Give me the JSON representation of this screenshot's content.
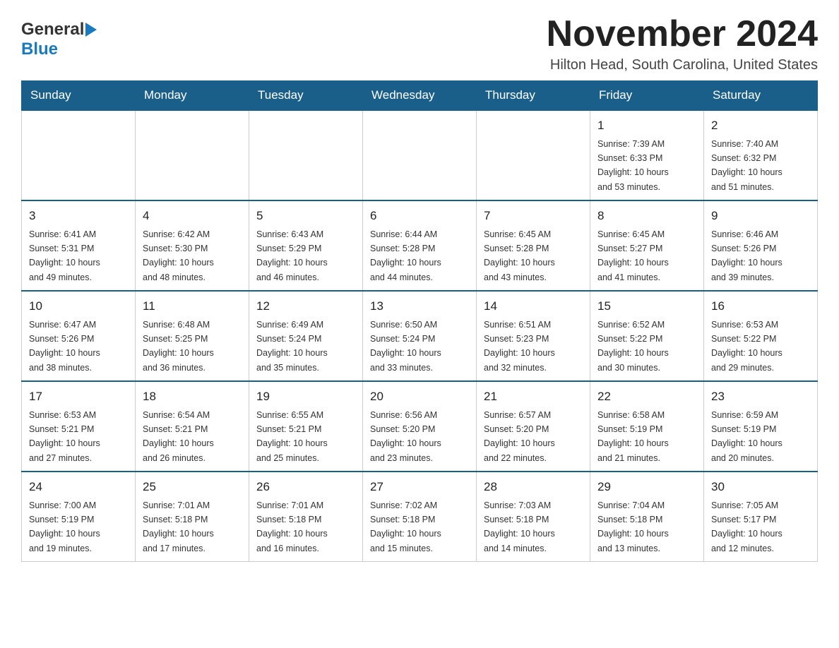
{
  "header": {
    "logo_general": "General",
    "logo_blue": "Blue",
    "month_title": "November 2024",
    "location": "Hilton Head, South Carolina, United States"
  },
  "calendar": {
    "days_of_week": [
      "Sunday",
      "Monday",
      "Tuesday",
      "Wednesday",
      "Thursday",
      "Friday",
      "Saturday"
    ],
    "weeks": [
      [
        {
          "day": "",
          "info": ""
        },
        {
          "day": "",
          "info": ""
        },
        {
          "day": "",
          "info": ""
        },
        {
          "day": "",
          "info": ""
        },
        {
          "day": "",
          "info": ""
        },
        {
          "day": "1",
          "info": "Sunrise: 7:39 AM\nSunset: 6:33 PM\nDaylight: 10 hours\nand 53 minutes."
        },
        {
          "day": "2",
          "info": "Sunrise: 7:40 AM\nSunset: 6:32 PM\nDaylight: 10 hours\nand 51 minutes."
        }
      ],
      [
        {
          "day": "3",
          "info": "Sunrise: 6:41 AM\nSunset: 5:31 PM\nDaylight: 10 hours\nand 49 minutes."
        },
        {
          "day": "4",
          "info": "Sunrise: 6:42 AM\nSunset: 5:30 PM\nDaylight: 10 hours\nand 48 minutes."
        },
        {
          "day": "5",
          "info": "Sunrise: 6:43 AM\nSunset: 5:29 PM\nDaylight: 10 hours\nand 46 minutes."
        },
        {
          "day": "6",
          "info": "Sunrise: 6:44 AM\nSunset: 5:28 PM\nDaylight: 10 hours\nand 44 minutes."
        },
        {
          "day": "7",
          "info": "Sunrise: 6:45 AM\nSunset: 5:28 PM\nDaylight: 10 hours\nand 43 minutes."
        },
        {
          "day": "8",
          "info": "Sunrise: 6:45 AM\nSunset: 5:27 PM\nDaylight: 10 hours\nand 41 minutes."
        },
        {
          "day": "9",
          "info": "Sunrise: 6:46 AM\nSunset: 5:26 PM\nDaylight: 10 hours\nand 39 minutes."
        }
      ],
      [
        {
          "day": "10",
          "info": "Sunrise: 6:47 AM\nSunset: 5:26 PM\nDaylight: 10 hours\nand 38 minutes."
        },
        {
          "day": "11",
          "info": "Sunrise: 6:48 AM\nSunset: 5:25 PM\nDaylight: 10 hours\nand 36 minutes."
        },
        {
          "day": "12",
          "info": "Sunrise: 6:49 AM\nSunset: 5:24 PM\nDaylight: 10 hours\nand 35 minutes."
        },
        {
          "day": "13",
          "info": "Sunrise: 6:50 AM\nSunset: 5:24 PM\nDaylight: 10 hours\nand 33 minutes."
        },
        {
          "day": "14",
          "info": "Sunrise: 6:51 AM\nSunset: 5:23 PM\nDaylight: 10 hours\nand 32 minutes."
        },
        {
          "day": "15",
          "info": "Sunrise: 6:52 AM\nSunset: 5:22 PM\nDaylight: 10 hours\nand 30 minutes."
        },
        {
          "day": "16",
          "info": "Sunrise: 6:53 AM\nSunset: 5:22 PM\nDaylight: 10 hours\nand 29 minutes."
        }
      ],
      [
        {
          "day": "17",
          "info": "Sunrise: 6:53 AM\nSunset: 5:21 PM\nDaylight: 10 hours\nand 27 minutes."
        },
        {
          "day": "18",
          "info": "Sunrise: 6:54 AM\nSunset: 5:21 PM\nDaylight: 10 hours\nand 26 minutes."
        },
        {
          "day": "19",
          "info": "Sunrise: 6:55 AM\nSunset: 5:21 PM\nDaylight: 10 hours\nand 25 minutes."
        },
        {
          "day": "20",
          "info": "Sunrise: 6:56 AM\nSunset: 5:20 PM\nDaylight: 10 hours\nand 23 minutes."
        },
        {
          "day": "21",
          "info": "Sunrise: 6:57 AM\nSunset: 5:20 PM\nDaylight: 10 hours\nand 22 minutes."
        },
        {
          "day": "22",
          "info": "Sunrise: 6:58 AM\nSunset: 5:19 PM\nDaylight: 10 hours\nand 21 minutes."
        },
        {
          "day": "23",
          "info": "Sunrise: 6:59 AM\nSunset: 5:19 PM\nDaylight: 10 hours\nand 20 minutes."
        }
      ],
      [
        {
          "day": "24",
          "info": "Sunrise: 7:00 AM\nSunset: 5:19 PM\nDaylight: 10 hours\nand 19 minutes."
        },
        {
          "day": "25",
          "info": "Sunrise: 7:01 AM\nSunset: 5:18 PM\nDaylight: 10 hours\nand 17 minutes."
        },
        {
          "day": "26",
          "info": "Sunrise: 7:01 AM\nSunset: 5:18 PM\nDaylight: 10 hours\nand 16 minutes."
        },
        {
          "day": "27",
          "info": "Sunrise: 7:02 AM\nSunset: 5:18 PM\nDaylight: 10 hours\nand 15 minutes."
        },
        {
          "day": "28",
          "info": "Sunrise: 7:03 AM\nSunset: 5:18 PM\nDaylight: 10 hours\nand 14 minutes."
        },
        {
          "day": "29",
          "info": "Sunrise: 7:04 AM\nSunset: 5:18 PM\nDaylight: 10 hours\nand 13 minutes."
        },
        {
          "day": "30",
          "info": "Sunrise: 7:05 AM\nSunset: 5:17 PM\nDaylight: 10 hours\nand 12 minutes."
        }
      ]
    ]
  }
}
